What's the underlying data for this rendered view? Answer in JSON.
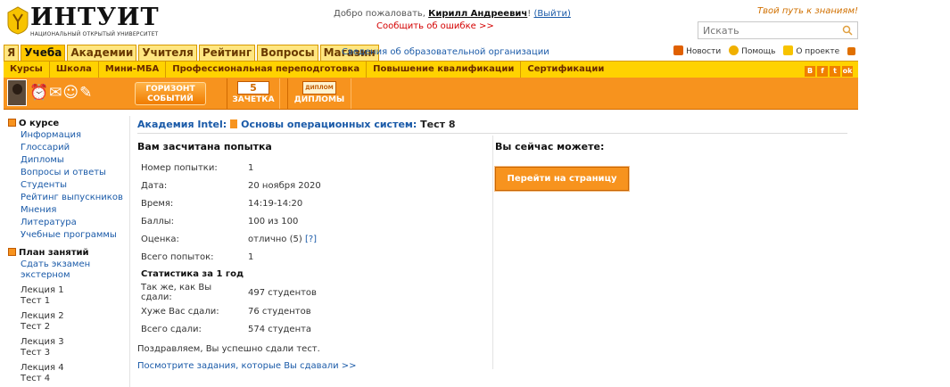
{
  "header": {
    "logo_name": "ИНТУИТ",
    "logo_sub": "НАЦИОНАЛЬНЫЙ ОТКРЫТЫЙ УНИВЕРСИТЕТ",
    "welcome_prefix": "Добро пожаловать,",
    "user_name": "Кирилл Андреевич",
    "welcome_bang": "!",
    "logout": "(Выйти)",
    "report_error": "Сообщить об ошибке >>",
    "slogan": "Твой путь к знаниям!",
    "search_placeholder": "Искать"
  },
  "tabs": [
    "Я",
    "Учеба",
    "Академии",
    "Учителя",
    "Рейтинг",
    "Вопросы",
    "Магазин"
  ],
  "active_tab": "Учеба",
  "org_link": "Сведения об образовательной организации",
  "top_links": {
    "news": "Новости",
    "help": "Помощь",
    "about": "О проекте"
  },
  "subnav": [
    "Курсы",
    "Школа",
    "Мини-МБА",
    "Профессиональная переподготовка",
    "Повышение квалификации",
    "Сертификации"
  ],
  "social": [
    "В",
    "f",
    "t",
    "ok"
  ],
  "orange_bar": {
    "horizon_line1": "ГОРИЗОНТ",
    "horizon_line2": "СОБЫТИЙ",
    "zachetka": "ЗАЧЕТКА",
    "zachetka_num": "5",
    "diplomy": "ДИПЛОМЫ",
    "diplom_pic": "ДИПЛОМ"
  },
  "sidebar": {
    "about_title": "О курсе",
    "about_links": [
      "Информация",
      "Глоссарий",
      "Дипломы",
      "Вопросы и ответы",
      "Студенты",
      "Рейтинг выпускников",
      "Мнения",
      "Литература",
      "Учебные программы"
    ],
    "plan_title": "План занятий",
    "plan_items": [
      {
        "a": "Сдать экзамен",
        "b": "экстерном",
        "link": true
      },
      {
        "a": "Лекция 1",
        "b": "Тест 1"
      },
      {
        "a": "Лекция 2",
        "b": "Тест 2"
      },
      {
        "a": "Лекция 3",
        "b": "Тест 3"
      },
      {
        "a": "Лекция 4",
        "b": "Тест 4"
      }
    ]
  },
  "breadcrumb": {
    "academy": "Академия Intel:",
    "course": "Основы операционных систем:",
    "test": "Тест 8"
  },
  "result": {
    "title": "Вам засчитана попытка",
    "rows": [
      {
        "k": "Номер попытки:",
        "v": "1"
      },
      {
        "k": "Дата:",
        "v": "20 ноября 2020"
      },
      {
        "k": "Время:",
        "v": "14:19-14:20"
      },
      {
        "k": "Баллы:",
        "v": "100 из 100"
      },
      {
        "k": "Оценка:",
        "v": "отлично (5)",
        "extra": "[?]"
      },
      {
        "k": "Всего попыток:",
        "v": "1"
      }
    ],
    "stats_title": "Статистика за 1 год",
    "stats": [
      {
        "k": "Так же, как Вы сдали:",
        "v": "497 студентов"
      },
      {
        "k": "Хуже Вас сдали:",
        "v": "76 студентов"
      },
      {
        "k": "Всего сдали:",
        "v": "574 студента"
      }
    ],
    "congrats": "Поздравляем, Вы успешно сдали тест.",
    "review_link": "Посмотрите задания, которые Вы сдавали >>"
  },
  "actions": {
    "title": "Вы сейчас можете:",
    "go_course": "Перейти на страницу курса"
  },
  "colors": {
    "orange": "#f7931e",
    "yellow": "#ffd200",
    "link": "#1a5aa8",
    "red": "#d40000"
  }
}
